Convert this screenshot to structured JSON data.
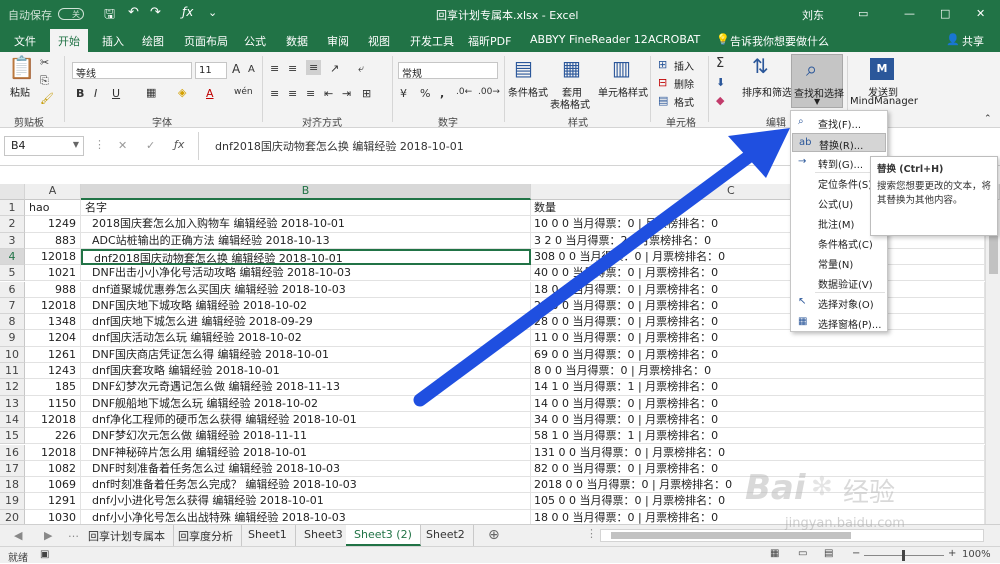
{
  "app": {
    "autosave_label": "自动保存",
    "autosave_state": "关",
    "title": "回享计划专属本.xlsx  -  Excel",
    "user": "刘东"
  },
  "tabs": [
    "文件",
    "开始",
    "插入",
    "绘图",
    "页面布局",
    "公式",
    "数据",
    "审阅",
    "视图",
    "开发工具",
    "福昕PDF",
    "ABBYY FineReader 12",
    "ACROBAT"
  ],
  "tell_me": "告诉我你想要做什么",
  "share_label": "共享",
  "ribbon": {
    "paste": "粘贴",
    "clipboard": "剪贴板",
    "font_name": "等线",
    "font_size": "11",
    "font_group": "字体",
    "align_group": "对齐方式",
    "number_format": "常规",
    "number_group": "数字",
    "cond_format": "条件格式",
    "table_format_1": "套用",
    "table_format_2": "表格格式",
    "cell_style": "单元格样式",
    "style_group": "样式",
    "insert": "插入",
    "delete": "删除",
    "format": "格式",
    "cells_group": "单元格",
    "sort_filter": "排序和筛选",
    "find_select": "查找和选择",
    "edit_group": "编辑",
    "send_to": "发送到",
    "mindmanager": "MindManager"
  },
  "namebox": "B4",
  "formula": "dnf2018国庆动物套怎么换 编辑经验 2018-10-01",
  "columns": [
    "A",
    "B",
    "C"
  ],
  "rows": [
    {
      "n": "1",
      "a": "hao",
      "b": "名字",
      "c": "数量"
    },
    {
      "n": "2",
      "a": "1249",
      "b": "2018国庆套怎么加入购物车 编辑经验 2018-10-01",
      "c": "10 0 0 当月得票：0 | 月票榜排名：0"
    },
    {
      "n": "3",
      "a": "883",
      "b": "ADC站桩输出的正确方法 编辑经验 2018-10-13",
      "c": "3 2 0 当月得票：2 | 月票榜排名：0"
    },
    {
      "n": "4",
      "a": "12018",
      "b": "dnf2018国庆动物套怎么换 编辑经验 2018-10-01",
      "c": "308 0 0 当月得票：0 | 月票榜排名：0"
    },
    {
      "n": "5",
      "a": "1021",
      "b": "DNF出击小小净化号活动攻略 编辑经验 2018-10-03",
      "c": "40 0 0 当月得票：0 | 月票榜排名：0"
    },
    {
      "n": "6",
      "a": "988",
      "b": "dnf道聚城优惠券怎么买国庆 编辑经验 2018-10-03",
      "c": "18 0 0 当月得票：0 | 月票榜排名：0"
    },
    {
      "n": "7",
      "a": "12018",
      "b": "DNF国庆地下城攻略 编辑经验 2018-10-02",
      "c": "21 0 0 当月得票：0 | 月票榜排名：0"
    },
    {
      "n": "8",
      "a": "1348",
      "b": "dnf国庆地下城怎么进 编辑经验 2018-09-29",
      "c": "28 0 0 当月得票：0 | 月票榜排名：0"
    },
    {
      "n": "9",
      "a": "1204",
      "b": "dnf国庆活动怎么玩 编辑经验 2018-10-02",
      "c": "11 0 0 当月得票：0 | 月票榜排名：0"
    },
    {
      "n": "10",
      "a": "1261",
      "b": "DNF国庆商店凭证怎么得 编辑经验 2018-10-01",
      "c": "69 0 0 当月得票：0 | 月票榜排名：0"
    },
    {
      "n": "11",
      "a": "1243",
      "b": "dnf国庆套攻略 编辑经验 2018-10-01",
      "c": "8 0 0 当月得票：0 | 月票榜排名：0"
    },
    {
      "n": "12",
      "a": "185",
      "b": "DNF幻梦次元奇遇记怎么做 编辑经验 2018-11-13",
      "c": "14 1 0 当月得票：1 | 月票榜排名：0"
    },
    {
      "n": "13",
      "a": "1150",
      "b": "DNF舰船地下城怎么玩 编辑经验 2018-10-02",
      "c": "14 0 0 当月得票：0 | 月票榜排名：0"
    },
    {
      "n": "14",
      "a": "12018",
      "b": "dnf净化工程师的硬币怎么获得 编辑经验 2018-10-01",
      "c": "34 0 0 当月得票：0 | 月票榜排名：0"
    },
    {
      "n": "15",
      "a": "226",
      "b": "DNF梦幻次元怎么做 编辑经验 2018-11-11",
      "c": "58 1 0 当月得票：1 | 月票榜排名：0"
    },
    {
      "n": "16",
      "a": "12018",
      "b": "DNF神秘碎片怎么用 编辑经验 2018-10-01",
      "c": "131 0 0 当月得票：0 | 月票榜排名：0"
    },
    {
      "n": "17",
      "a": "1082",
      "b": "DNF时刻准备着任务怎么过 编辑经验 2018-10-03",
      "c": "82 0 0 当月得票：0 | 月票榜排名：0"
    },
    {
      "n": "18",
      "a": "1069",
      "b": "dnf时刻准备着任务怎么完成？ 编辑经验 2018-10-03",
      "c": "2018 0 0 当月得票：0 | 月票榜排名：0"
    },
    {
      "n": "19",
      "a": "1291",
      "b": "dnf小小进化号怎么获得 编辑经验 2018-10-01",
      "c": "105 0 0 当月得票：0 | 月票榜排名：0"
    },
    {
      "n": "20",
      "a": "1030",
      "b": "dnf小小净化号怎么出战特殊 编辑经验 2018-10-03",
      "c": "18 0 0 当月得票：0 | 月票榜排名：0"
    },
    {
      "n": "21",
      "a": "1093",
      "b": "dnf小小净化号怎么派遣 编辑经验 2018-10-03",
      "c": "10 0 0 当月得票：0 | 月票榜排名：0"
    },
    {
      "n": "22",
      "a": "1090",
      "b": "dnf小小净化号怎么去特殊 编辑经验 2018-10-03",
      "c": "82 0 0 当月得票：0 | 月票榜排名：0"
    }
  ],
  "menu": [
    {
      "icon": "⌕",
      "label": "查找(F)..."
    },
    {
      "icon": "ab",
      "label": "替换(R)..."
    },
    {
      "icon": "→",
      "label": "转到(G)..."
    },
    {
      "icon": "",
      "label": "定位条件(S)..."
    },
    {
      "icon": "",
      "label": "公式(U)"
    },
    {
      "icon": "",
      "label": "批注(M)"
    },
    {
      "icon": "",
      "label": "条件格式(C)"
    },
    {
      "icon": "",
      "label": "常量(N)"
    },
    {
      "icon": "",
      "label": "数据验证(V)"
    },
    {
      "icon": "↖",
      "label": "选择对象(O)"
    },
    {
      "icon": "▦",
      "label": "选择窗格(P)..."
    }
  ],
  "tooltip": {
    "title": "替换 (Ctrl+H)",
    "body": "搜索您想要更改的文本，将其替换为其他内容。"
  },
  "sheets": [
    "回享计划专属本",
    "回享度分析",
    "Sheet1",
    "Sheet3",
    "Sheet3 (2)",
    "Sheet2"
  ],
  "active_sheet": "Sheet3 (2)",
  "status": {
    "ready": "就绪",
    "zoom": "100%"
  },
  "watermark": {
    "brand": "Bai",
    "brand2": "经验",
    "url": "jingyan.baidu.com"
  },
  "colors": {
    "excel_green": "#217346",
    "arrow_blue": "#1f4fe0"
  }
}
